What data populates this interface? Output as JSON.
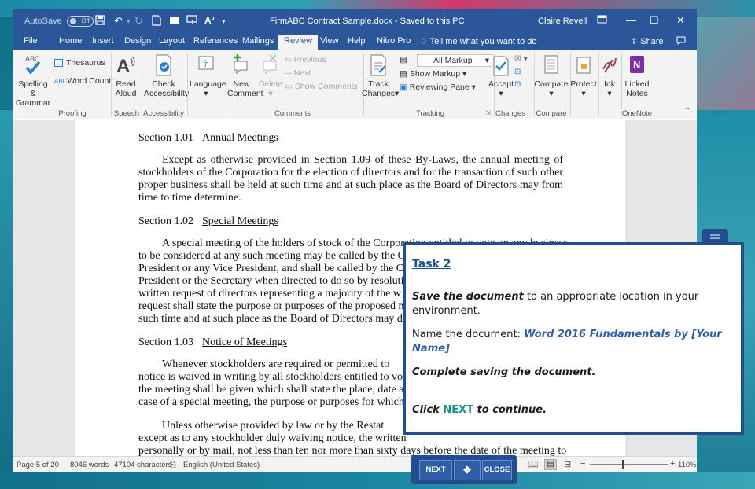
{
  "titlebar": {
    "autosave_label": "AutoSave",
    "autosave_state": "Off",
    "document_title": "FirmABC Contract Sample.docx - Saved to this PC",
    "user_name": "Claire Revell"
  },
  "tabs": [
    {
      "label": "File"
    },
    {
      "label": "Home"
    },
    {
      "label": "Insert"
    },
    {
      "label": "Design"
    },
    {
      "label": "Layout"
    },
    {
      "label": "References"
    },
    {
      "label": "Mailings"
    },
    {
      "label": "Review"
    },
    {
      "label": "View"
    },
    {
      "label": "Help"
    },
    {
      "label": "Nitro Pro"
    }
  ],
  "tell_me": "Tell me what you want to do",
  "share_label": "Share",
  "ribbon": {
    "spelling_label": "Spelling &",
    "grammar_label": "Grammar",
    "thesaurus_label": "Thesaurus",
    "word_count_label": "Word Count",
    "proofing_group": "Proofing",
    "read_label": "Read",
    "aloud_label": "Aloud",
    "speech_group": "Speech",
    "check_label": "Check",
    "accessibility_label": "Accessibility",
    "accessibility_group": "Accessibility",
    "language_label": "Language",
    "new_label": "New",
    "comment_label": "Comment",
    "delete_label": "Delete",
    "previous_label": "Previous",
    "next_label": "Next",
    "show_comments_label": "Show Comments",
    "comments_group": "Comments",
    "track_label": "Track",
    "changes_label": "Changes",
    "markup_value": "All Markup",
    "show_markup_label": "Show Markup",
    "reviewing_pane_label": "Reviewing Pane",
    "tracking_group": "Tracking",
    "accept_label": "Accept",
    "changes_group": "Changes",
    "compare_label": "Compare",
    "compare_group": "Compare",
    "protect_label": "Protect",
    "ink_label": "Ink",
    "linked_label": "Linked",
    "notes_label": "Notes",
    "onenote_group": "OneNote"
  },
  "document": {
    "s101_num": "Section 1.01",
    "s101_title": "Annual Meetings",
    "s101_text": "Except as otherwise provided in Section 1.09 of these By-Laws, the annual meeting of stockholders of the Corporation for the election of directors and for the transaction of such other proper business shall be held at such time and at such place as the Board of Directors may from time to time determine.",
    "s102_num": "Section 1.02",
    "s102_title": "Special Meetings",
    "s102_line1": "A special meeting of the holders of stock of the Corporation entitled to vote on any business",
    "s102_line2": "to be considered at any such meeting may be called by the C",
    "s102_line3": "President or any Vice President, and shall be called by the C",
    "s102_line4": "President or the Secretary when directed to do so by resolutio",
    "s102_line5": "written request of directors representing a majority of the w",
    "s102_line6": "request shall state the purpose or purposes of the proposed me",
    "s102_line7": "such time and at such place as the Board of Directors may de",
    "s103_num": "Section 1.03",
    "s103_title": "Notice of Meetings",
    "s103_line1": "Whenever stockholders are required or permitted to",
    "s103_line2": "notice is waived in writing by all stockholders entitled to vo",
    "s103_line3": "the meeting shall be given which shall state the place, date a",
    "s103_line4": "case of a special meeting, the purpose or purposes for which",
    "p4_line1": "Unless otherwise provided by law or by the Restat",
    "p4_line2": "except as to any stockholder duly waiving notice, the written",
    "p4_line3": "personally or by mail, not less than ten nor more than sixty days before the date of the meeting to"
  },
  "statusbar": {
    "page": "Page 5 of 20",
    "words": "8046 words",
    "characters": "47104 characters",
    "language": "English (United States)",
    "zoom": "110%"
  },
  "task": {
    "title": "Task 2",
    "save_bold": "Save the document",
    "save_rest": " to an appropriate location in your environment.",
    "name_prefix": "Name the document: ",
    "name_value": "Word 2016 Fundamentals by [Your Name]",
    "complete": "Complete saving the document.",
    "click": "Click ",
    "next_word": "NEXT",
    "continue": " to continue."
  },
  "nav": {
    "next": "NEXT",
    "close": "CLOSE"
  },
  "colors": {
    "word_blue": "#2b579a",
    "task_panel": "#234e8e",
    "next_teal": "#1b8e8e"
  }
}
